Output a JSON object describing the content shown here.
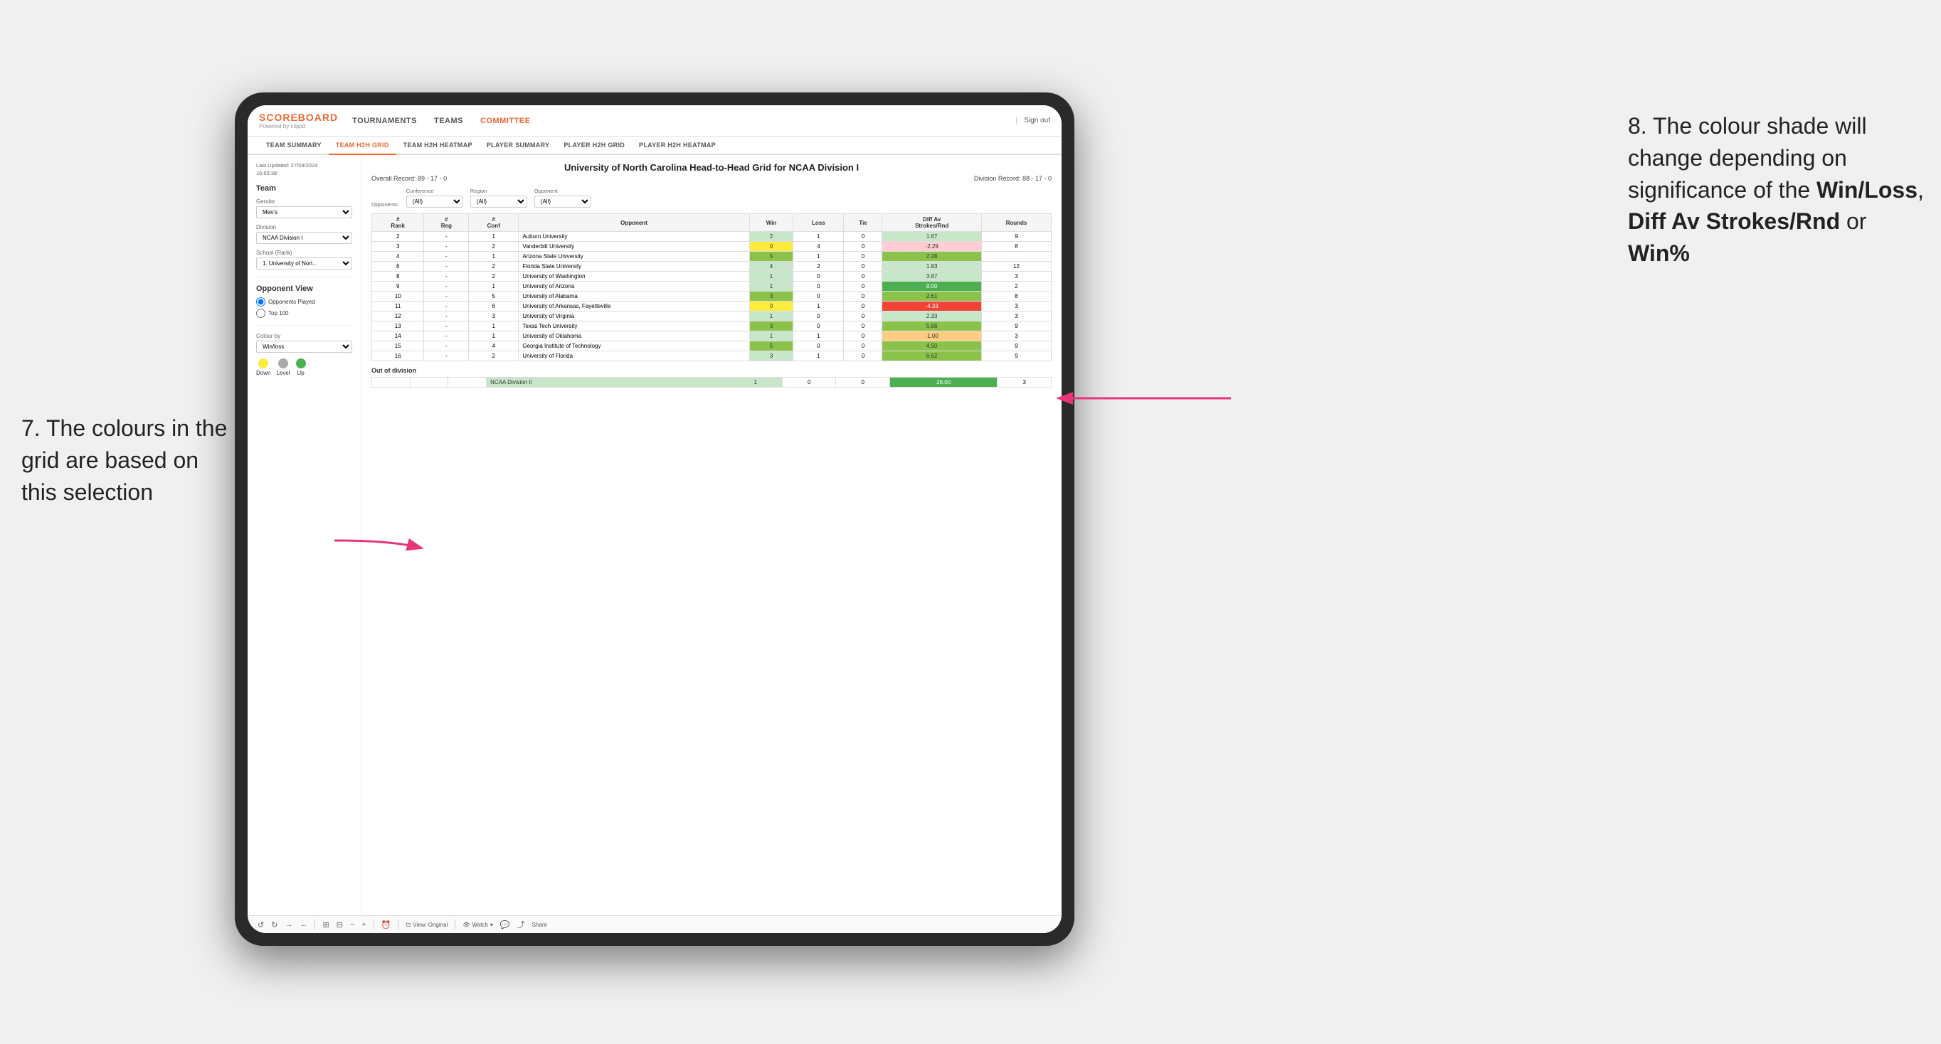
{
  "annotations": {
    "left": "7. The colours in the grid are based on this selection",
    "right_prefix": "8. The colour shade will change depending on significance of the ",
    "right_bold1": "Win/Loss",
    "right_sep1": ", ",
    "right_bold2": "Diff Av Strokes/Rnd",
    "right_sep2": " or ",
    "right_bold3": "Win%"
  },
  "nav": {
    "logo": "SCOREBOARD",
    "logo_sub": "Powered by clippd",
    "links": [
      "TOURNAMENTS",
      "TEAMS",
      "COMMITTEE"
    ],
    "active_link": "COMMITTEE",
    "sign_out": "Sign out"
  },
  "sub_nav": {
    "items": [
      "TEAM SUMMARY",
      "TEAM H2H GRID",
      "TEAM H2H HEATMAP",
      "PLAYER SUMMARY",
      "PLAYER H2H GRID",
      "PLAYER H2H HEATMAP"
    ],
    "active": "TEAM H2H GRID"
  },
  "left_panel": {
    "last_updated_label": "Last Updated: 27/03/2024",
    "last_updated_time": "16:55:38",
    "team_section": "Team",
    "gender_label": "Gender",
    "gender_value": "Men's",
    "division_label": "Division",
    "division_value": "NCAA Division I",
    "school_label": "School (Rank)",
    "school_value": "1. University of Nort...",
    "opponent_view_label": "Opponent View",
    "radio_options": [
      "Opponents Played",
      "Top 100"
    ],
    "radio_active": "Opponents Played",
    "colour_by_label": "Colour by",
    "colour_by_value": "Win/loss",
    "legend": {
      "down_label": "Down",
      "level_label": "Level",
      "up_label": "Up",
      "down_color": "#ffeb3b",
      "level_color": "#aaa",
      "up_color": "#4caf50"
    }
  },
  "grid": {
    "title": "University of North Carolina Head-to-Head Grid for NCAA Division I",
    "overall_record_label": "Overall Record:",
    "overall_record": "89 - 17 - 0",
    "division_record_label": "Division Record:",
    "division_record": "88 - 17 - 0",
    "filters": {
      "conference_label": "Conference",
      "conference_value": "(All)",
      "region_label": "Region",
      "region_value": "(All)",
      "opponent_label": "Opponent",
      "opponent_value": "(All)",
      "opponents_label": "Opponents:"
    },
    "table_headers": [
      "#\nRank",
      "#\nReg",
      "#\nConf",
      "Opponent",
      "Win",
      "Loss",
      "Tie",
      "Diff Av\nStrokes/Rnd",
      "Rounds"
    ],
    "rows": [
      {
        "rank": "2",
        "reg": "-",
        "conf": "1",
        "opponent": "Auburn University",
        "win": "2",
        "loss": "1",
        "tie": "0",
        "diff": "1.67",
        "rounds": "9",
        "win_color": "cell-green-light",
        "diff_color": "cell-green-light"
      },
      {
        "rank": "3",
        "reg": "-",
        "conf": "2",
        "opponent": "Vanderbilt University",
        "win": "0",
        "loss": "4",
        "tie": "0",
        "diff": "-2.29",
        "rounds": "8",
        "win_color": "cell-yellow",
        "diff_color": "cell-red-light"
      },
      {
        "rank": "4",
        "reg": "-",
        "conf": "1",
        "opponent": "Arizona State University",
        "win": "5",
        "loss": "1",
        "tie": "0",
        "diff": "2.28",
        "rounds": "",
        "win_color": "cell-green-mid",
        "diff_color": "cell-green-mid"
      },
      {
        "rank": "6",
        "reg": "-",
        "conf": "2",
        "opponent": "Florida State University",
        "win": "4",
        "loss": "2",
        "tie": "0",
        "diff": "1.83",
        "rounds": "12",
        "win_color": "cell-green-light",
        "diff_color": "cell-green-light"
      },
      {
        "rank": "8",
        "reg": "-",
        "conf": "2",
        "opponent": "University of Washington",
        "win": "1",
        "loss": "0",
        "tie": "0",
        "diff": "3.67",
        "rounds": "3",
        "win_color": "cell-green-light",
        "diff_color": "cell-green-light"
      },
      {
        "rank": "9",
        "reg": "-",
        "conf": "1",
        "opponent": "University of Arizona",
        "win": "1",
        "loss": "0",
        "tie": "0",
        "diff": "9.00",
        "rounds": "2",
        "win_color": "cell-green-light",
        "diff_color": "cell-green-dark"
      },
      {
        "rank": "10",
        "reg": "-",
        "conf": "5",
        "opponent": "University of Alabama",
        "win": "3",
        "loss": "0",
        "tie": "0",
        "diff": "2.61",
        "rounds": "8",
        "win_color": "cell-green-mid",
        "diff_color": "cell-green-mid"
      },
      {
        "rank": "11",
        "reg": "-",
        "conf": "6",
        "opponent": "University of Arkansas, Fayetteville",
        "win": "0",
        "loss": "1",
        "tie": "0",
        "diff": "-4.33",
        "rounds": "3",
        "win_color": "cell-yellow",
        "diff_color": "cell-red"
      },
      {
        "rank": "12",
        "reg": "-",
        "conf": "3",
        "opponent": "University of Virginia",
        "win": "1",
        "loss": "0",
        "tie": "0",
        "diff": "2.33",
        "rounds": "3",
        "win_color": "cell-green-light",
        "diff_color": "cell-green-light"
      },
      {
        "rank": "13",
        "reg": "-",
        "conf": "1",
        "opponent": "Texas Tech University",
        "win": "3",
        "loss": "0",
        "tie": "0",
        "diff": "5.56",
        "rounds": "9",
        "win_color": "cell-green-mid",
        "diff_color": "cell-green-mid"
      },
      {
        "rank": "14",
        "reg": "-",
        "conf": "1",
        "opponent": "University of Oklahoma",
        "win": "1",
        "loss": "1",
        "tie": "0",
        "diff": "-1.00",
        "rounds": "3",
        "win_color": "cell-green-light",
        "diff_color": "cell-orange-light"
      },
      {
        "rank": "15",
        "reg": "-",
        "conf": "4",
        "opponent": "Georgia Institute of Technology",
        "win": "5",
        "loss": "0",
        "tie": "0",
        "diff": "4.50",
        "rounds": "9",
        "win_color": "cell-green-mid",
        "diff_color": "cell-green-mid"
      },
      {
        "rank": "16",
        "reg": "-",
        "conf": "2",
        "opponent": "University of Florida",
        "win": "3",
        "loss": "1",
        "tie": "0",
        "diff": "6.62",
        "rounds": "9",
        "win_color": "cell-green-light",
        "diff_color": "cell-green-mid"
      }
    ],
    "out_of_division_label": "Out of division",
    "out_of_division_row": {
      "division": "NCAA Division II",
      "win": "1",
      "loss": "0",
      "tie": "0",
      "diff": "26.00",
      "rounds": "3",
      "win_color": "cell-green-light",
      "diff_color": "cell-green-dark"
    }
  },
  "toolbar": {
    "view_label": "View: Original",
    "watch_label": "Watch",
    "share_label": "Share"
  }
}
